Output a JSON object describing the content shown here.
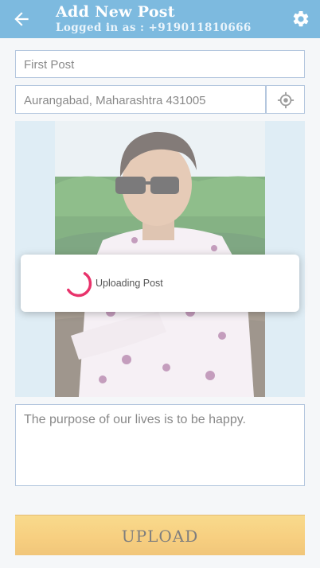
{
  "app_bar": {
    "title": "Add New Post",
    "subtitle": "Logged in as : +919011810666",
    "back_icon": "arrow-left-icon",
    "settings_icon": "gear-icon",
    "color": "#1f88c9"
  },
  "form": {
    "post_title": "First Post",
    "location": "Aurangabad, Maharashtra 431005",
    "location_icon": "gps-crosshair-icon",
    "caption": "The purpose of our lives is to be happy.",
    "upload_label": "UPLOAD"
  },
  "dialog": {
    "message": "Uploading Post",
    "spinner_color": "#e8336b"
  }
}
